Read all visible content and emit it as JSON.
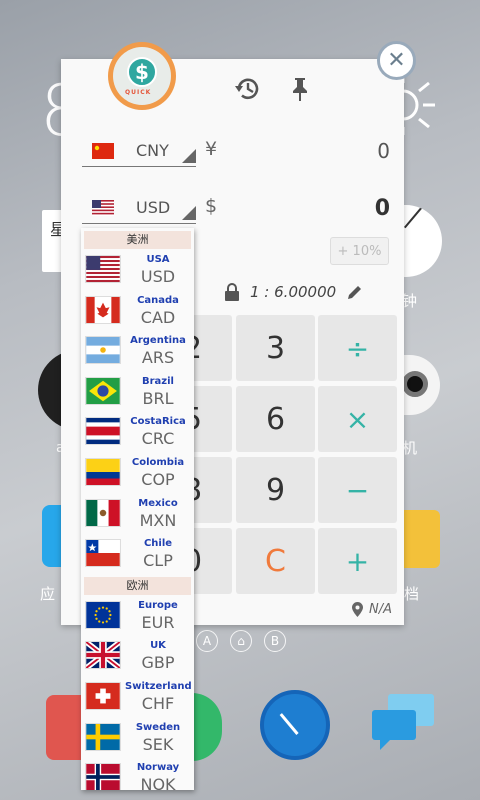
{
  "background": {
    "clock_digit": "8",
    "widget_left_char": "星",
    "label_clock": "钟",
    "label_camera": "机",
    "label_apps": "应",
    "label_docs": "档",
    "label_left_row2": "a",
    "dots": [
      "A",
      "⌂",
      "B"
    ]
  },
  "app": {
    "logo_text": "QUICK",
    "logo_symbol": "$"
  },
  "converter": {
    "from": {
      "code": "CNY",
      "symbol": "¥",
      "value": "0",
      "flag": "cn-flag"
    },
    "to": {
      "code": "USD",
      "symbol": "$",
      "value": "0",
      "flag": "us-flag"
    },
    "percent_button": "+ 10%",
    "rate": "1 : 6.00000",
    "location": "N/A"
  },
  "keypad": [
    "2",
    "3",
    "÷",
    "5",
    "6",
    "×",
    "8",
    "9",
    "−",
    "0",
    "C",
    "+"
  ],
  "dropdown": {
    "groups": [
      {
        "header": "美洲",
        "items": [
          {
            "name": "USA",
            "code": "USD",
            "flag": "us-flag"
          },
          {
            "name": "Canada",
            "code": "CAD",
            "flag": "ca-flag"
          },
          {
            "name": "Argentina",
            "code": "ARS",
            "flag": "ar-flag"
          },
          {
            "name": "Brazil",
            "code": "BRL",
            "flag": "br-flag"
          },
          {
            "name": "CostaRica",
            "code": "CRC",
            "flag": "cr-flag"
          },
          {
            "name": "Colombia",
            "code": "COP",
            "flag": "co-flag"
          },
          {
            "name": "Mexico",
            "code": "MXN",
            "flag": "mx-flag"
          },
          {
            "name": "Chile",
            "code": "CLP",
            "flag": "cl-flag"
          }
        ]
      },
      {
        "header": "欧洲",
        "items": [
          {
            "name": "Europe",
            "code": "EUR",
            "flag": "eu-flag"
          },
          {
            "name": "UK",
            "code": "GBP",
            "flag": "gb-flag"
          },
          {
            "name": "Switzerland",
            "code": "CHF",
            "flag": "ch-flag"
          },
          {
            "name": "Sweden",
            "code": "SEK",
            "flag": "se-flag"
          },
          {
            "name": "Norway",
            "code": "NOK",
            "flag": "no-flag"
          }
        ]
      }
    ]
  },
  "colors": {
    "accent": "#35b3a6",
    "clear": "#f07a3c",
    "link": "#1f3fb0"
  }
}
